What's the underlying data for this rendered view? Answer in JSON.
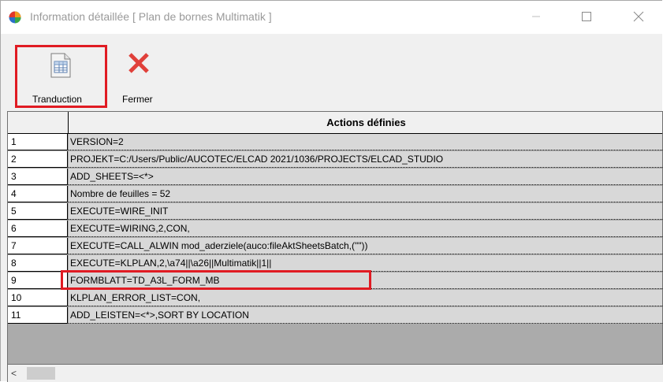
{
  "window": {
    "title": "Information détaillée [ Plan de bornes Multimatik ]",
    "icon": "app-globe-icon"
  },
  "titlebar_buttons": {
    "minimize_icon": "minimize-icon",
    "maximize_icon": "maximize-icon",
    "close_icon": "close-icon"
  },
  "toolbar": {
    "translate_label": "Tranduction",
    "translate_icon": "document-table-icon",
    "close_label": "Fermer",
    "close_icon": "red-x-icon"
  },
  "grid": {
    "column_header": "Actions définies",
    "rows": [
      {
        "num": "1",
        "text": "VERSION=2"
      },
      {
        "num": "2",
        "text": "PROJEKT=C:/Users/Public/AUCOTEC/ELCAD 2021/1036/PROJECTS/ELCAD_STUDIO"
      },
      {
        "num": "3",
        "text": "ADD_SHEETS=<*>"
      },
      {
        "num": "4",
        "text": "Nombre de feuilles = 52"
      },
      {
        "num": "5",
        "text": "EXECUTE=WIRE_INIT"
      },
      {
        "num": "6",
        "text": "EXECUTE=WIRING,2,CON,"
      },
      {
        "num": "7",
        "text": "EXECUTE=CALL_ALWIN mod_aderziele(auco:fileAktSheetsBatch,(\"\"))"
      },
      {
        "num": "8",
        "text": "EXECUTE=KLPLAN,2,\\a74||\\a26||Multimatik||1||"
      },
      {
        "num": "9",
        "text": "FORMBLATT=TD_A3L_FORM_MB"
      },
      {
        "num": "10",
        "text": "KLPLAN_ERROR_LIST=CON,"
      },
      {
        "num": "11",
        "text": "ADD_LEISTEN=<*>,SORT BY LOCATION"
      }
    ]
  },
  "scrollbar": {
    "left_arrow": "<"
  },
  "colors": {
    "highlight": "#e01b23",
    "cell_bg": "#d8d8d8",
    "grid_bg": "#ababab"
  }
}
